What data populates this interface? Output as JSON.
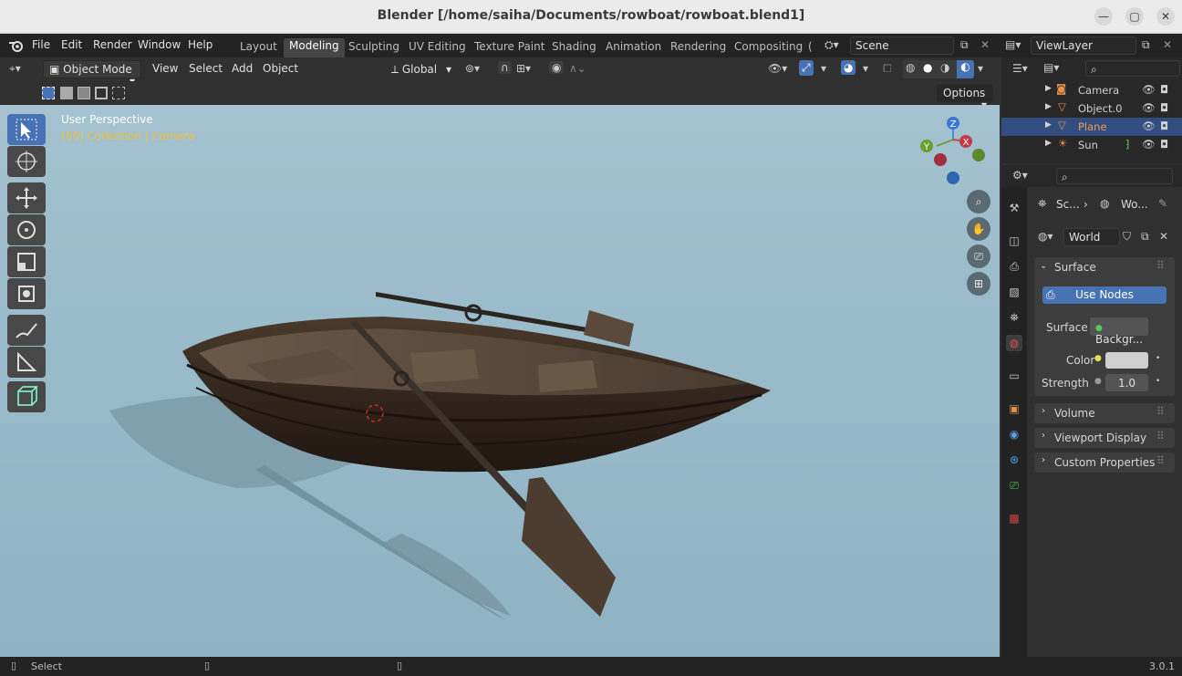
{
  "window": {
    "title": "Blender [/home/saiha/Documents/rowboat/rowboat.blend1]"
  },
  "menus": [
    "File",
    "Edit",
    "Render",
    "Window",
    "Help"
  ],
  "workspaces": [
    "Layout",
    "Modeling",
    "Sculpting",
    "UV Editing",
    "Texture Paint",
    "Shading",
    "Animation",
    "Rendering",
    "Compositing",
    "("
  ],
  "active_workspace": "Modeling",
  "scene": {
    "name": "Scene"
  },
  "view_layer": {
    "name": "ViewLayer"
  },
  "viewport_header": {
    "mode": "Object Mode",
    "menus": [
      "View",
      "Select",
      "Add",
      "Object"
    ],
    "orientation": "Global",
    "options_label": "Options"
  },
  "viewport": {
    "perspective": "User Perspective",
    "collection_info": "(60) Collection | Camera",
    "gizmo_axes": {
      "x": "X",
      "y": "Y",
      "z": "Z"
    }
  },
  "outliner": {
    "items": [
      {
        "name": "Camera",
        "icon": "camera-icon",
        "selected": false
      },
      {
        "name": "Object.0",
        "icon": "mesh-icon",
        "selected": false
      },
      {
        "name": "Plane",
        "icon": "mesh-icon",
        "selected": true
      },
      {
        "name": "Sun",
        "icon": "light-icon",
        "selected": false
      }
    ]
  },
  "properties": {
    "breadcrumb": {
      "scene": "Sc...",
      "world": "Wo..."
    },
    "world_name": "World",
    "surface_panel": "Surface",
    "use_nodes": "Use Nodes",
    "surface_label": "Surface",
    "surface_value": "Backgr...",
    "color_label": "Color",
    "strength_label": "Strength",
    "strength_value": "1.0",
    "collapsed_panels": [
      "Volume",
      "Viewport Display",
      "Custom Properties"
    ]
  },
  "statusbar": {
    "left": "Select",
    "version": "3.0.1"
  },
  "colors": {
    "accent": "#4772b3",
    "selected_row": "#334d80",
    "collection_text": "#f0c040"
  }
}
